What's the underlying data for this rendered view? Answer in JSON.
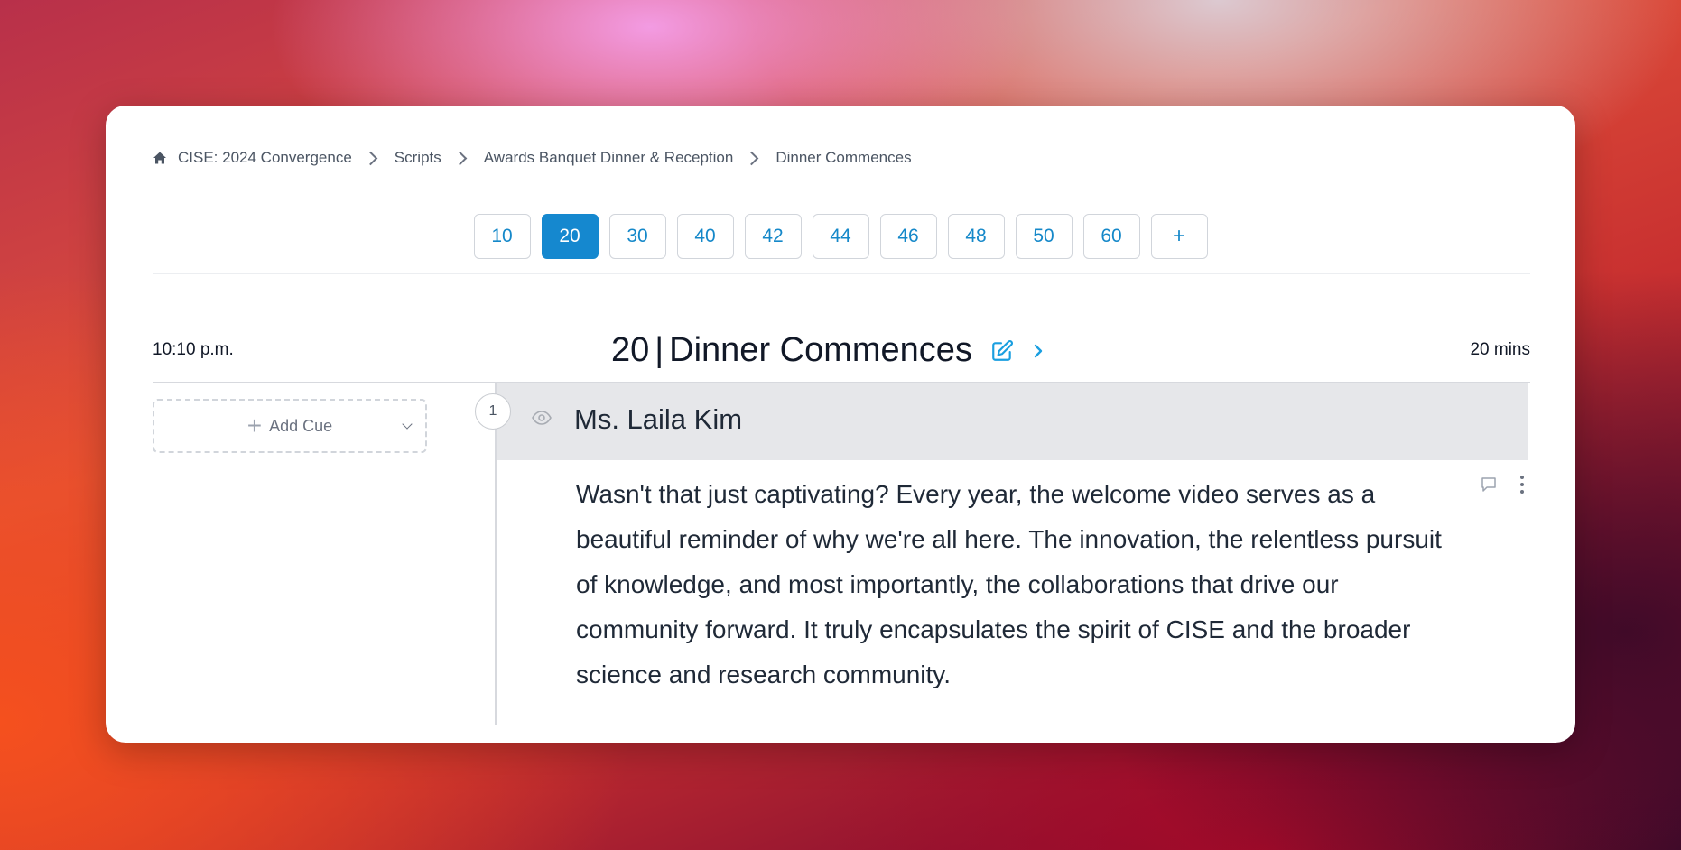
{
  "breadcrumb": {
    "items": [
      {
        "label": "CISE: 2024 Convergence"
      },
      {
        "label": "Scripts"
      },
      {
        "label": "Awards Banquet Dinner & Reception"
      },
      {
        "label": "Dinner Commences"
      }
    ]
  },
  "pager": {
    "pages": [
      "10",
      "20",
      "30",
      "40",
      "42",
      "44",
      "46",
      "48",
      "50",
      "60"
    ],
    "active": "20",
    "add_label": "+"
  },
  "segment": {
    "time": "10:10 p.m.",
    "number": "20",
    "separator": "|",
    "name": "Dinner Commences",
    "duration": "20 mins"
  },
  "add_cue": {
    "label": "Add Cue",
    "plus": "+"
  },
  "cue": {
    "number": "1",
    "speaker": "Ms. Laila Kim",
    "text": "Wasn't that just captivating? Every year, the welcome video serves as a beautiful reminder of why we're all here. The innovation, the relentless pursuit of knowledge, and most importantly, the collaborations that drive our community forward. It truly encapsulates the spirit of CISE and the broader science and research community."
  },
  "colors": {
    "accent": "#1588cf",
    "speaker_bar": "#e6e7ea",
    "text": "#1f2937"
  },
  "icons": [
    "home-icon",
    "chevron-right-icon",
    "edit-icon",
    "next-icon",
    "eye-icon",
    "comment-icon",
    "more-vertical-icon",
    "chevron-down-icon"
  ]
}
